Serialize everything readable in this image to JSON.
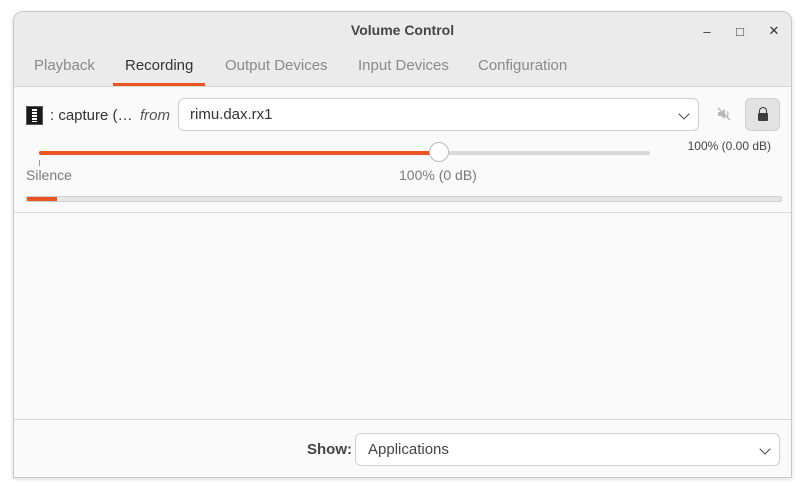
{
  "window": {
    "title": "Volume Control",
    "controls": {
      "minimize": "–",
      "maximize": "□",
      "close": "✕"
    }
  },
  "tabs": [
    {
      "label": "Playback",
      "active": false
    },
    {
      "label": "Recording",
      "active": true
    },
    {
      "label": "Output Devices",
      "active": false
    },
    {
      "label": "Input Devices",
      "active": false
    },
    {
      "label": "Configuration",
      "active": false
    }
  ],
  "stream": {
    "icon": "app-icon",
    "name": ": capture (…",
    "from_label": "from",
    "device": "rimu.dax.rx1",
    "mute_icon": "speaker-muted-icon",
    "lock_icon": "lock-icon",
    "volume_value": "100% (0.00 dB)",
    "volume_fraction": 0.655,
    "scale_labels": {
      "silence": "Silence",
      "hundred": "100% (0 dB)"
    },
    "level_fraction": 0.04
  },
  "footer": {
    "show_label": "Show:",
    "show_value": "Applications"
  },
  "colors": {
    "accent": "#e95420"
  }
}
